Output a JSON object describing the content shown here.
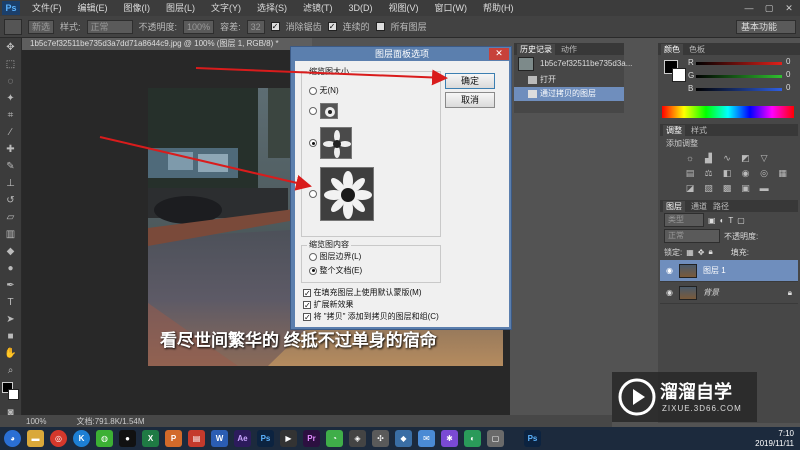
{
  "app": {
    "logo": "Ps"
  },
  "menu": [
    "文件(F)",
    "编辑(E)",
    "图像(I)",
    "图层(L)",
    "文字(Y)",
    "选择(S)",
    "滤镜(T)",
    "3D(D)",
    "视图(V)",
    "窗口(W)",
    "帮助(H)"
  ],
  "options_bar": {
    "new_sel_label": "新选",
    "style_label": "样式:",
    "style_value": "正常",
    "opacity_label": "不透明度:",
    "opacity_value": "100%",
    "tolerance_label": "容差:",
    "tolerance_value": "32",
    "anti_alias": "消除锯齿",
    "contiguous": "连续的",
    "all_layers": "所有图层",
    "workspace": "基本功能"
  },
  "document": {
    "tab_title": "1b5c7ef32511be735d3a7dd71a8644c9.jpg @ 100% (图层 1, RGB/8) *",
    "caption": "看尽世间繁华的 终抵不过单身的宿命"
  },
  "status": {
    "zoom": "100%",
    "doc_info": "文档:791.8K/1.54M"
  },
  "dialog": {
    "title": "图层面板选项",
    "thumb_size_group": "缩览图大小",
    "thumb_none": "无(N)",
    "ok": "确定",
    "cancel": "取消",
    "content_group": "缩览图内容",
    "layer_bounds": "图层边界(L)",
    "entire_doc": "整个文档(E)",
    "use_default_masks": "在填充图层上使用默认蒙版(M)",
    "expand_new_effects": "扩展新效果",
    "copy_suffix": "将 \"拷贝\" 添加到拷贝的图层和组(C)"
  },
  "history_panel": {
    "tabs": [
      "历史记录",
      "动作"
    ],
    "snapshot_name": "1b5c7ef32511be735d3a...",
    "items": [
      "打开",
      "通过拷贝的图层"
    ]
  },
  "color_panel": {
    "tabs": [
      "颜色",
      "色板"
    ],
    "channels": [
      {
        "name": "R",
        "value": "0"
      },
      {
        "name": "G",
        "value": "0"
      },
      {
        "name": "B",
        "value": "0"
      }
    ],
    "slider_colors": [
      "#e0201a",
      "#2fc02f",
      "#2f5fe0"
    ]
  },
  "adjustments_panel": {
    "tabs": [
      "调整",
      "样式"
    ],
    "hint": "添加调整"
  },
  "layers_panel": {
    "tabs": [
      "图层",
      "通道",
      "路径"
    ],
    "kind_label": "类型",
    "blend_mode": "正常",
    "opacity_label": "不透明度:",
    "lock_label": "锁定:",
    "fill_label": "填充:",
    "layers": [
      {
        "name": "图层 1",
        "selected": true
      },
      {
        "name": "背景",
        "selected": false
      }
    ]
  },
  "watermark": {
    "brand": "溜溜自学",
    "url": "ZIXUE.3D66.COM"
  },
  "taskbar": {
    "apps": [
      "X",
      "Ai",
      "P",
      "W",
      "Ae",
      "Ps",
      "Pr"
    ],
    "time": "7:10",
    "date": "2019/11/11"
  },
  "colors": {
    "accent": "#6f8ebd",
    "dialog_frame": "#5b7fae",
    "arrow": "#d91c1c"
  }
}
